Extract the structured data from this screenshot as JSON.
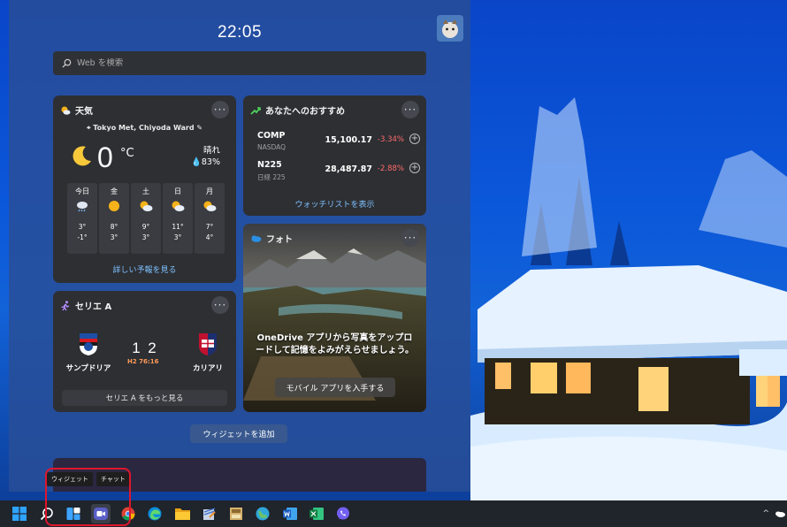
{
  "panel": {
    "clock": "22:05",
    "search": {
      "placeholder": "Web を検索"
    }
  },
  "weather": {
    "title": "天気",
    "location": "Tokyo Met, Chiyoda Ward",
    "temperature": "0",
    "unit": "°C",
    "condition": "晴れ",
    "humidity": "83%",
    "forecast": [
      {
        "day": "今日",
        "icon": "cloud-rain-icon",
        "high": "3°",
        "low": "-1°"
      },
      {
        "day": "金",
        "icon": "sun-icon",
        "high": "8°",
        "low": "3°"
      },
      {
        "day": "土",
        "icon": "partly-sunny-icon",
        "high": "9°",
        "low": "3°"
      },
      {
        "day": "日",
        "icon": "partly-sunny-icon",
        "high": "11°",
        "low": "3°"
      },
      {
        "day": "月",
        "icon": "partly-sunny-icon",
        "high": "7°",
        "low": "4°"
      }
    ],
    "more_link": "詳しい予報を見る"
  },
  "stocks": {
    "title": "あなたへのおすすめ",
    "rows": [
      {
        "symbol": "COMP",
        "exchange": "NASDAQ",
        "price": "15,100.17",
        "change": "-3.34%"
      },
      {
        "symbol": "N225",
        "exchange": "日経 225",
        "price": "28,487.87",
        "change": "-2.88%"
      }
    ],
    "watchlist_link": "ウォッチリストを表示"
  },
  "photos": {
    "title": "フォト",
    "message": "OneDrive アプリから写真をアップロードして記憶をよみがえらせましょう。",
    "button": "モバイル アプリを入手する"
  },
  "seriea": {
    "title": "セリエ A",
    "home_team": "サンプドリア",
    "away_team": "カリアリ",
    "home_score": "1",
    "away_score": "2",
    "period": "H2 76:16",
    "more_button": "セリエ A をもっと見る"
  },
  "add_widgets": "ウィジェットを追加",
  "tooltips": {
    "widgets": "ウィジェット",
    "chat": "チャット"
  },
  "colors": {
    "accent_link": "#7fc1ff",
    "negative": "#ff6b6b",
    "highlight": "#e0162b"
  }
}
